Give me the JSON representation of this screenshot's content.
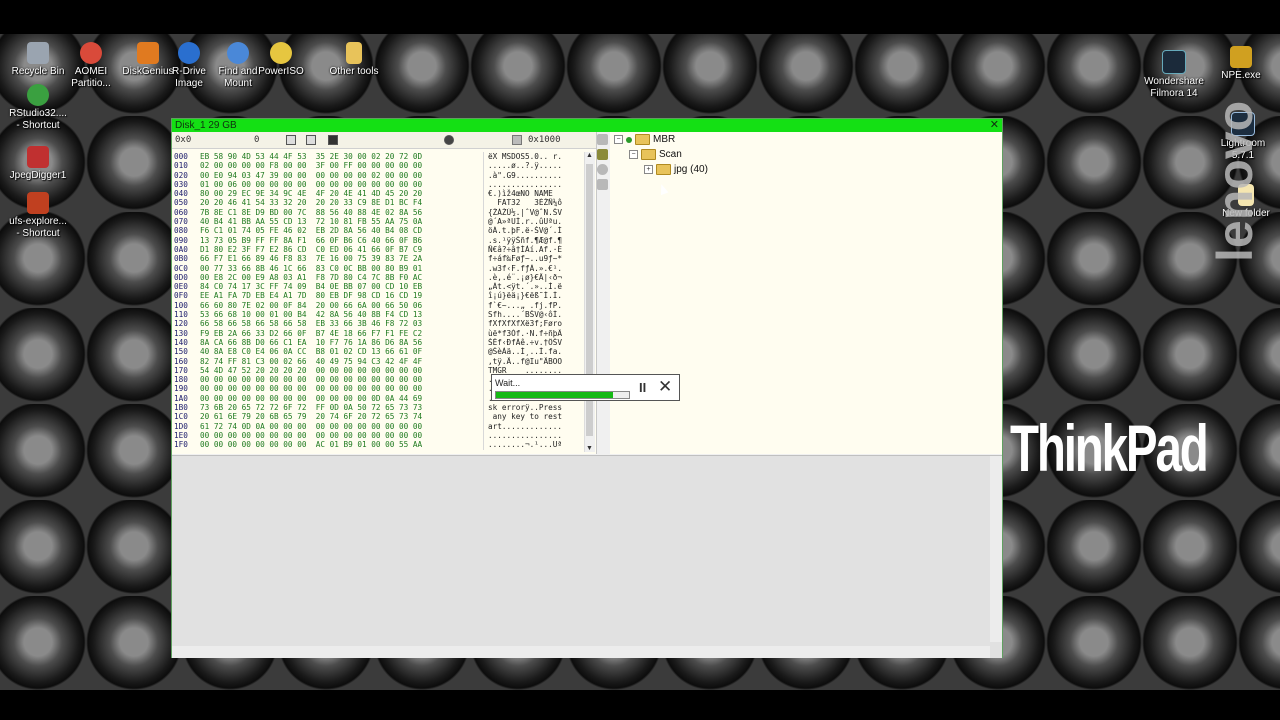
{
  "desktop": {
    "icons_left": [
      {
        "id": "recycle-bin",
        "label": "Recycle Bin",
        "icon": "recycle-bin-icon",
        "color": "#9aa4b0"
      },
      {
        "id": "aomei",
        "label": "AOMEI\nPartitio...",
        "icon": "aomei-icon",
        "color": "#d94a3a"
      },
      {
        "id": "diskgenius",
        "label": "DiskGenius",
        "icon": "diskgenius-icon",
        "color": "#e07a20"
      },
      {
        "id": "rdrive",
        "label": "R-Drive\nImage",
        "icon": "rdrive-icon",
        "color": "#2a6fcf"
      },
      {
        "id": "findmount",
        "label": "Find and\nMount",
        "icon": "find-mount-icon",
        "color": "#4a88d8"
      },
      {
        "id": "poweriso",
        "label": "PowerISO",
        "icon": "poweriso-icon",
        "color": "#e6c640"
      },
      {
        "id": "othertools",
        "label": "Other tools",
        "icon": "folder-icon",
        "color": "#e8c35a"
      },
      {
        "id": "rstudio",
        "label": "RStudio32....\n- Shortcut",
        "icon": "rstudio-icon",
        "color": "#3aa040"
      },
      {
        "id": "jpegdigger",
        "label": "JpegDigger1",
        "icon": "jpegdigger-icon",
        "color": "#c03030"
      },
      {
        "id": "ufsexplorer",
        "label": "ufs-explore...\n- Shortcut",
        "icon": "ufs-explorer-icon",
        "color": "#c04020"
      }
    ],
    "icons_right": [
      {
        "id": "filmora",
        "label": "Wondershare\nFilmora 14",
        "icon": "filmora-icon",
        "color": "#1b2a3a"
      },
      {
        "id": "npe",
        "label": "NPE.exe",
        "icon": "npe-icon",
        "color": "#d0a020"
      },
      {
        "id": "lightroom",
        "label": "Lightroom\n5.7.1",
        "icon": "lightroom-icon",
        "color": "#1c2d3f"
      },
      {
        "id": "newfolder",
        "label": "New folder",
        "icon": "folder-icon",
        "color": "#f5e6b0"
      }
    ],
    "brand_text": "ThinkPad",
    "vertical_brand": "lenovo"
  },
  "window": {
    "title": "Disk_1  29 GB",
    "close_glyph": "✕",
    "toolbar": {
      "offset": "0x0",
      "value": "0",
      "block": "0x1000"
    },
    "hex_rows": [
      {
        "off": "000",
        "hex": "EB 58 90 4D 53 44 4F 53  35 2E 30 00 02 20 72 0D",
        "asc": "ëX MSDOS5.0.. r."
      },
      {
        "off": "010",
        "hex": "02 00 00 00 00 F8 00 00  3F 00 FF 00 00 00 00 00",
        "asc": ".....ø..?.ÿ....."
      },
      {
        "off": "020",
        "hex": "00 E0 94 03 47 39 00 00  00 00 00 00 02 00 00 00",
        "asc": ".à\".G9.........."
      },
      {
        "off": "030",
        "hex": "01 00 06 00 00 00 00 00  00 00 00 00 00 00 00 00",
        "asc": "................"
      },
      {
        "off": "040",
        "hex": "80 00 29 EC 9E 34 9C 4E  4F 20 4E 41 4D 45 20 20",
        "asc": "€.)ìž4œNO NAME  "
      },
      {
        "off": "050",
        "hex": "20 20 46 41 54 33 32 20  20 20 33 C9 8E D1 BC F4",
        "asc": "  FAT32   3ÉŽÑ¼ô"
      },
      {
        "off": "060",
        "hex": "7B 8E C1 8E D9 BD 00 7C  88 56 40 88 4E 02 8A 56",
        "asc": "{ŽÁŽÙ½.|ˆV@ˆN.ŠV"
      },
      {
        "off": "070",
        "hex": "40 B4 41 BB AA 55 CD 13  72 10 81 FB 55 AA 75 0A",
        "asc": "@´A»ªUÍ.r..ûUªu."
      },
      {
        "off": "080",
        "hex": "F6 C1 01 74 05 FE 46 02  EB 2D 8A 56 40 B4 08 CD",
        "asc": "öÁ.t.þF.ë-ŠV@´.Í"
      },
      {
        "off": "090",
        "hex": "13 73 05 B9 FF FF 8A F1  66 0F B6 C6 40 66 0F B6",
        "asc": ".s.¹ÿÿŠñf.¶Æ@f.¶"
      },
      {
        "off": "0A0",
        "hex": "D1 80 E2 3F F7 E2 86 CD  C0 ED 06 41 66 0F B7 C9",
        "asc": "Ñ€â?÷â†ÍÀí.Af.·É"
      },
      {
        "off": "0B0",
        "hex": "66 F7 E1 66 89 46 F8 83  7E 16 00 75 39 83 7E 2A",
        "asc": "f÷áf‰Føƒ~..u9ƒ~*"
      },
      {
        "off": "0C0",
        "hex": "00 77 33 66 8B 46 1C 66  83 C0 0C BB 00 80 B9 01",
        "asc": ".w3f‹F.fƒÀ.».€¹."
      },
      {
        "off": "0D0",
        "hex": "00 E8 2C 00 E9 A8 03 A1  F8 7D 80 C4 7C 8B F0 AC",
        "asc": ".è,.é¨.¡ø}€Ä|‹ð¬"
      },
      {
        "off": "0E0",
        "hex": "84 C0 74 17 3C FF 74 09  B4 0E BB 07 00 CD 10 EB",
        "asc": "„Àt.<ÿt.´.»..Í.ë"
      },
      {
        "off": "0F0",
        "hex": "EE A1 FA 7D EB E4 A1 7D  80 EB DF 98 CD 16 CD 19",
        "asc": "î¡ú}ëä¡}€ëß˜Í.Í."
      },
      {
        "off": "100",
        "hex": "66 60 80 7E 02 00 0F 84  20 00 66 6A 00 66 50 06",
        "asc": "f`€~...„ .fj.fP."
      },
      {
        "off": "110",
        "hex": "53 66 68 10 00 01 00 B4  42 8A 56 40 8B F4 CD 13",
        "asc": "Sfh....´BŠV@‹ôÍ."
      },
      {
        "off": "120",
        "hex": "66 58 66 58 66 58 66 58  EB 33 66 3B 46 F8 72 03",
        "asc": "fXfXfXfXë3f;Føro"
      },
      {
        "off": "130",
        "hex": "F9 EB 2A 66 33 D2 66 0F  B7 4E 18 66 F7 F1 FE C2",
        "asc": "ùë*f3Òf.·N.f÷ñþÂ"
      },
      {
        "off": "140",
        "hex": "8A CA 66 8B D0 66 C1 EA  10 F7 76 1A 86 D6 8A 56",
        "asc": "ŠÊf‹ÐfÁê.÷v.†ÖŠV"
      },
      {
        "off": "150",
        "hex": "40 8A E8 C0 E4 06 0A CC  B8 01 02 CD 13 66 61 0F",
        "asc": "@ŠèÀä..Ì¸..Í.fa."
      },
      {
        "off": "160",
        "hex": "82 74 FF 81 C3 00 02 66  40 49 75 94 C3 42 4F 4F",
        "asc": ",tÿ.Ã..f@Iu\"ÃBOO"
      },
      {
        "off": "170",
        "hex": "54 4D 47 52 20 20 20 20  00 00 00 00 00 00 00 00",
        "asc": "TMGR    ........"
      },
      {
        "off": "180",
        "hex": "00 00 00 00 00 00 00 00  00 00 00 00 00 00 00 00",
        "asc": "................"
      },
      {
        "off": "190",
        "hex": "00 00 00 00 00 00 00 00  00 00 00 00 00 00 00 00",
        "asc": "................"
      },
      {
        "off": "1A0",
        "hex": "00 00 00 00 00 00 00 00  00 00 00 00 0D 0A 44 69",
        "asc": "..............Di"
      },
      {
        "off": "1B0",
        "hex": "73 6B 20 65 72 72 6F 72  FF 0D 0A 50 72 65 73 73",
        "asc": "sk errorÿ..Press"
      },
      {
        "off": "1C0",
        "hex": "20 61 6E 79 20 6B 65 79  20 74 6F 20 72 65 73 74",
        "asc": " any key to rest"
      },
      {
        "off": "1D0",
        "hex": "61 72 74 0D 0A 00 00 00  00 00 00 00 00 00 00 00",
        "asc": "art............."
      },
      {
        "off": "1E0",
        "hex": "00 00 00 00 00 00 00 00  00 00 00 00 00 00 00 00",
        "asc": "................"
      },
      {
        "off": "1F0",
        "hex": "00 00 00 00 00 00 00 00  AC 01 B9 01 00 00 55 AA",
        "asc": "........¬.¹...Uª"
      }
    ],
    "tree": {
      "root": "MBR",
      "child": "Scan",
      "grandchild": "jpg (40)",
      "collapse_glyph": "−",
      "expand_glyph": "+"
    },
    "wait_dialog": {
      "label": "Wait...",
      "progress": 0.88,
      "pause_glyph": "II",
      "close_glyph": "✕"
    }
  }
}
